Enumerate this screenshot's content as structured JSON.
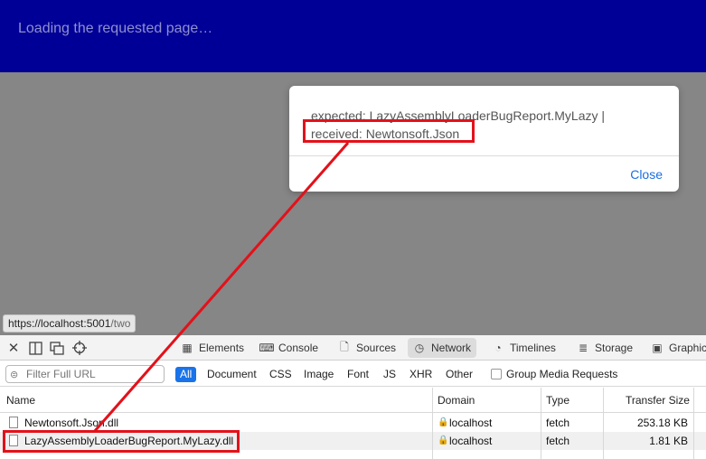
{
  "banner": {
    "loading_text": "Loading the requested page…"
  },
  "dialog": {
    "message_line1": "expected: LazyAssemblyLoaderBugReport.MyLazy |",
    "message_line2": "received: Newtonsoft.Json",
    "close_label": "Close"
  },
  "status_url": {
    "host": "https://localhost:5001",
    "path": "/two"
  },
  "devtools": {
    "tabs": [
      {
        "label": "Elements"
      },
      {
        "label": "Console"
      },
      {
        "label": "Sources"
      },
      {
        "label": "Network"
      },
      {
        "label": "Timelines"
      },
      {
        "label": "Storage"
      },
      {
        "label": "Graphic"
      }
    ],
    "filter_placeholder": "Filter Full URL",
    "type_filters": [
      "All",
      "Document",
      "CSS",
      "Image",
      "Font",
      "JS",
      "XHR",
      "Other"
    ],
    "group_media_label": "Group Media Requests",
    "columns": {
      "name": "Name",
      "domain": "Domain",
      "type": "Type",
      "size": "Transfer Size"
    },
    "rows": [
      {
        "name": "Newtonsoft.Json.dll",
        "domain": "localhost",
        "type": "fetch",
        "size": "253.18 KB"
      },
      {
        "name": "LazyAssemblyLoaderBugReport.MyLazy.dll",
        "domain": "localhost",
        "type": "fetch",
        "size": "1.81 KB"
      }
    ]
  },
  "annotation_color": "#e3111a",
  "accent_color": "#1a73e8"
}
